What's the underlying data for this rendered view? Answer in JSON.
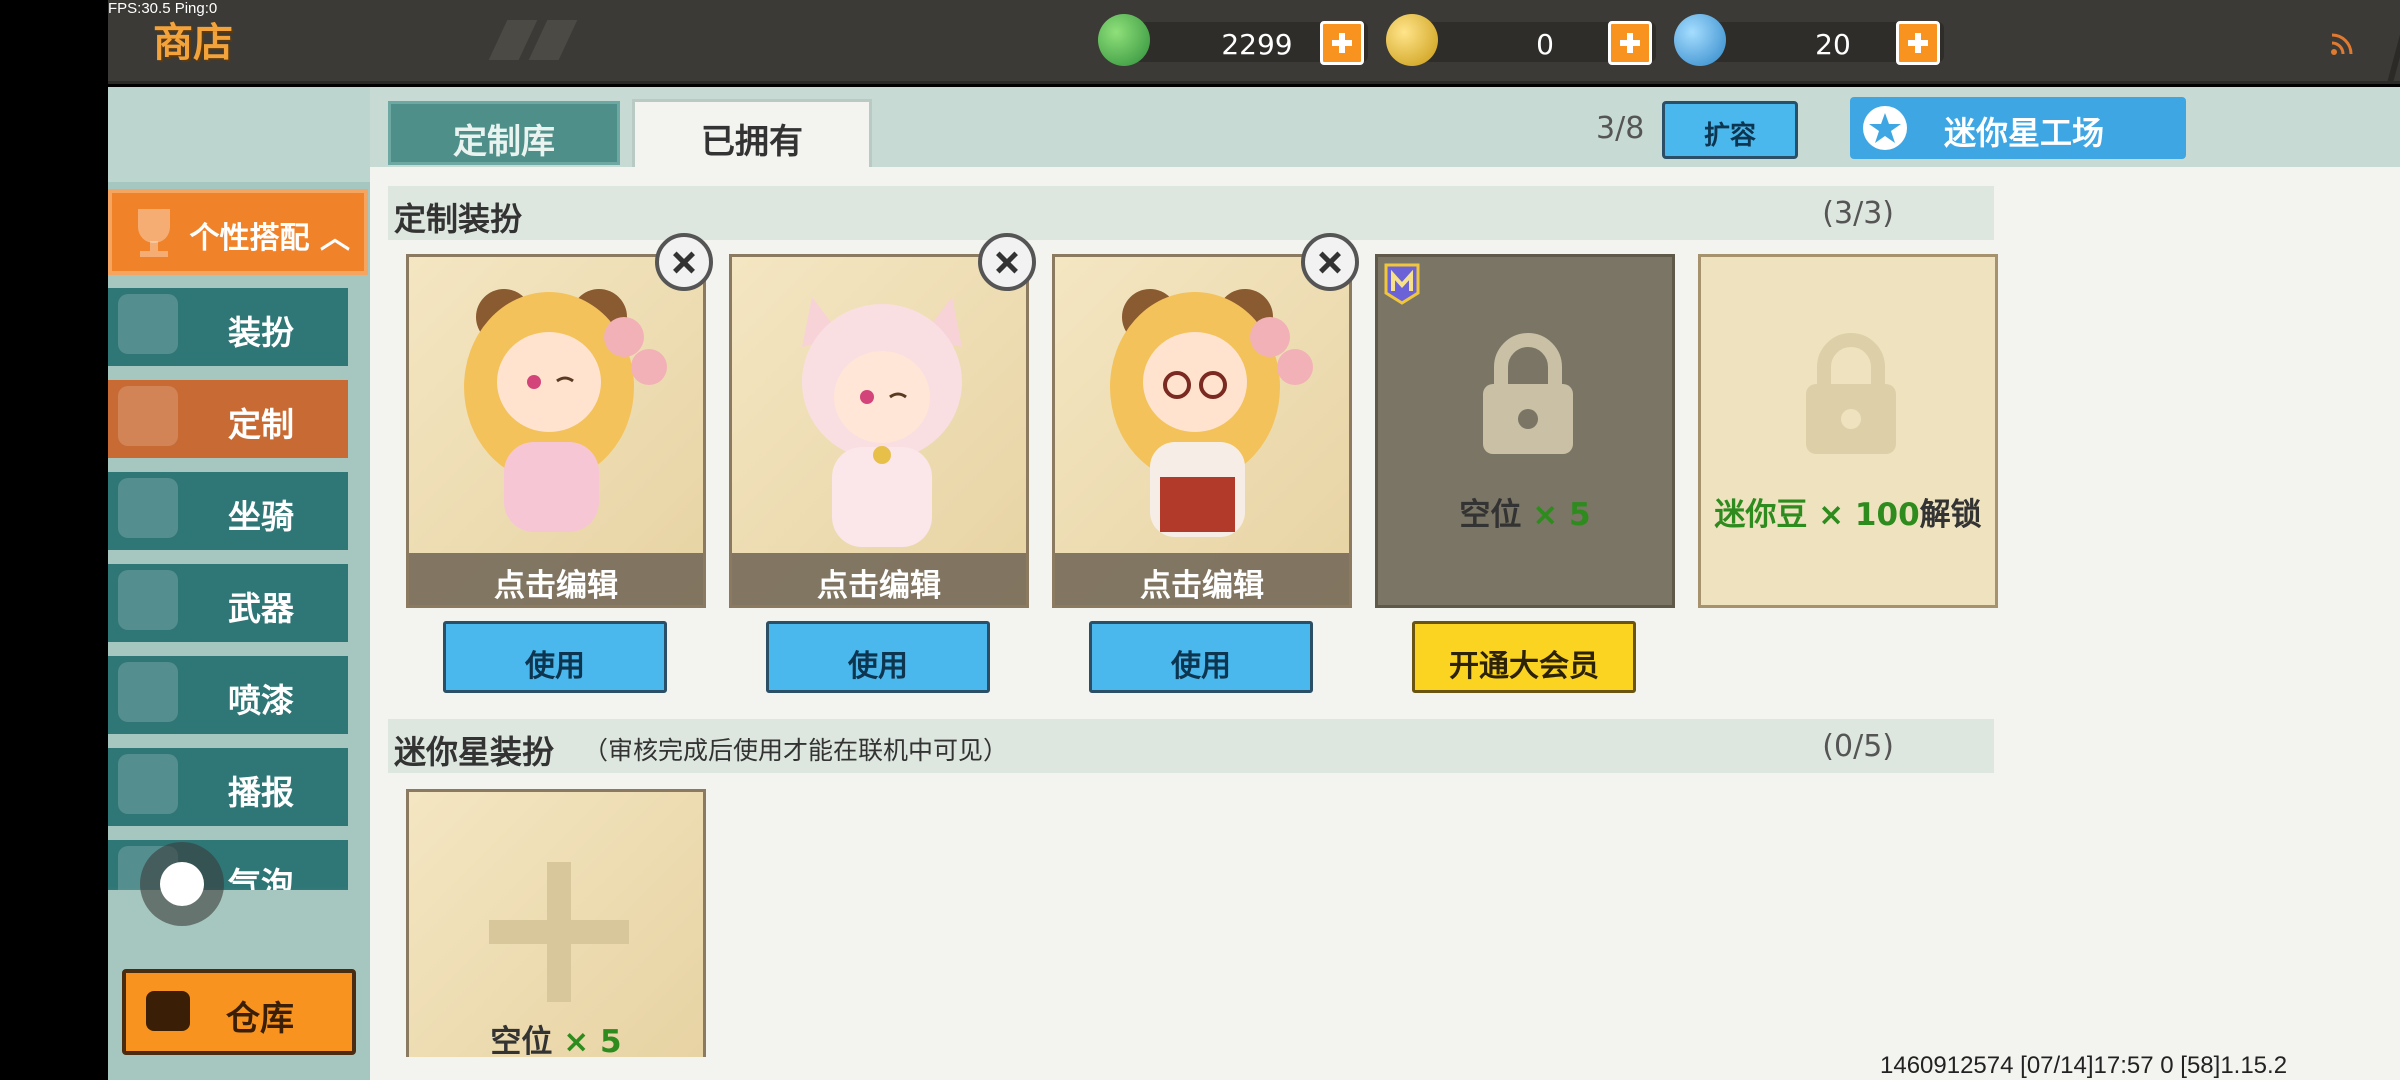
{
  "debug": {
    "fps": "FPS:30.5  Ping:0"
  },
  "header": {
    "title": "商店",
    "currencies": [
      {
        "icon": "green-gem-icon",
        "value": "2299",
        "color": "#3fae4a"
      },
      {
        "icon": "gold-coin-icon",
        "value": "0",
        "color": "#f2c21b"
      },
      {
        "icon": "blue-coin-icon",
        "value": "20",
        "color": "#39a6e8"
      }
    ]
  },
  "sidebar": {
    "category_header": "个性搭配",
    "items": [
      {
        "label": "装扮",
        "icon": "outfit-icon"
      },
      {
        "label": "定制",
        "icon": "custom-icon"
      },
      {
        "label": "坐骑",
        "icon": "mount-icon"
      },
      {
        "label": "武器",
        "icon": "weapon-icon"
      },
      {
        "label": "喷漆",
        "icon": "spray-icon"
      },
      {
        "label": "播报",
        "icon": "broadcast-icon"
      },
      {
        "label": "气泡",
        "icon": "bubble-icon"
      }
    ],
    "warehouse": "仓库"
  },
  "tabs": {
    "custom_library": "定制库",
    "owned": "已拥有"
  },
  "toolbar": {
    "capacity": "3/8",
    "expand": "扩容",
    "workshop": "迷你星工场"
  },
  "section_custom": {
    "title": "定制装扮",
    "count": "(3/3)",
    "cards": [
      {
        "edit": "点击编辑",
        "use": "使用"
      },
      {
        "edit": "点击编辑",
        "use": "使用"
      },
      {
        "edit": "点击编辑",
        "use": "使用"
      }
    ],
    "locked_vip": {
      "slot": "空位",
      "times": "× 5",
      "button": "开通大会员"
    },
    "locked_beans": {
      "item": "迷你豆",
      "amount": "× 100",
      "action": "解锁"
    }
  },
  "section_mini": {
    "title": "迷你星装扮",
    "note": "（审核完成后使用才能在联机中可见）",
    "count": "(0/5)",
    "add_slot": {
      "slot": "空位",
      "times": "× 5"
    }
  },
  "footer": {
    "info": "1460912574   [07/14]17:57 0   [58]1.15.2"
  }
}
